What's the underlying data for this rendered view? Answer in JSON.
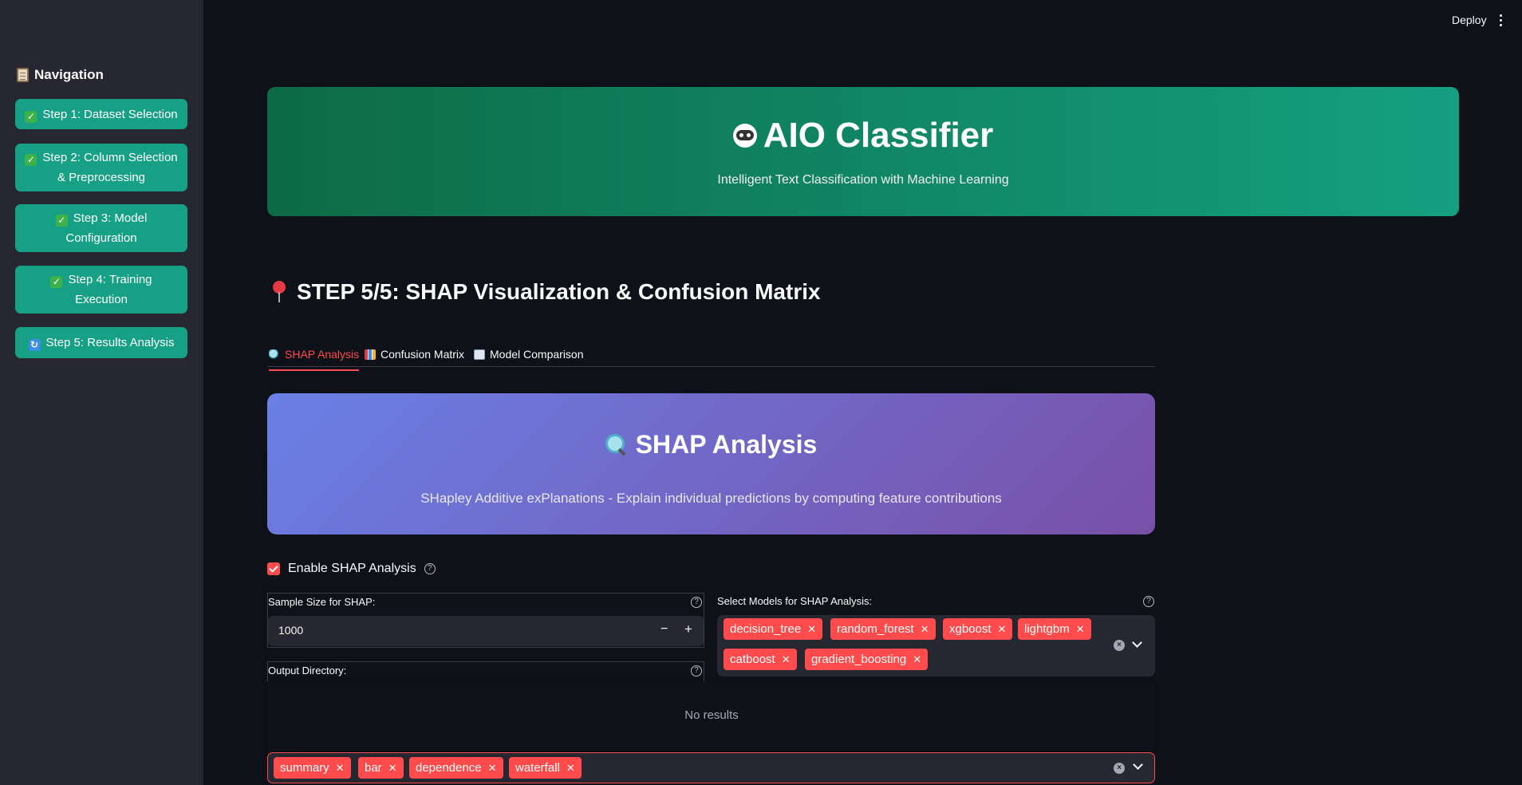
{
  "sidebar": {
    "title": "Navigation",
    "items": [
      {
        "label": "Step 1: Dataset Selection",
        "status": "done"
      },
      {
        "label": "Step 2: Column Selection & Preprocessing",
        "status": "done"
      },
      {
        "label": "Step 3: Model Configuration",
        "status": "done"
      },
      {
        "label": "Step 4: Training Execution",
        "status": "done"
      },
      {
        "label": "Step 5: Results Analysis",
        "status": "current"
      }
    ]
  },
  "toolbar": {
    "deploy_label": "Deploy"
  },
  "hero": {
    "title": "AIO Classifier",
    "subtitle": "Intelligent Text Classification with Machine Learning"
  },
  "step_heading": "STEP 5/5: SHAP Visualization & Confusion Matrix",
  "tabs": [
    {
      "label": "SHAP Analysis",
      "active": true,
      "icon": "magnifier-icon"
    },
    {
      "label": "Confusion Matrix",
      "active": false,
      "icon": "bar-chart-icon"
    },
    {
      "label": "Model Comparison",
      "active": false,
      "icon": "line-chart-icon"
    }
  ],
  "shap_banner": {
    "title": "SHAP Analysis",
    "subtitle": "SHapley Additive exPlanations - Explain individual predictions by computing feature contributions"
  },
  "enable_shap": {
    "label": "Enable SHAP Analysis",
    "checked": true
  },
  "sample_size": {
    "label": "Sample Size for SHAP:",
    "value": "1000"
  },
  "output_dir": {
    "label": "Output Directory:"
  },
  "models_select": {
    "label": "Select Models for SHAP Analysis:",
    "selected": [
      "decision_tree",
      "random_forest",
      "xgboost",
      "lightgbm",
      "catboost",
      "gradient_boosting"
    ]
  },
  "dropdown": {
    "empty_text": "No results"
  },
  "plot_types": {
    "selected": [
      "summary",
      "bar",
      "dependence",
      "waterfall"
    ]
  },
  "colors": {
    "accent": "#ff4b4b",
    "sidebar_button": "#16a085",
    "background": "#0e1117",
    "sidebar_bg": "#262730"
  }
}
